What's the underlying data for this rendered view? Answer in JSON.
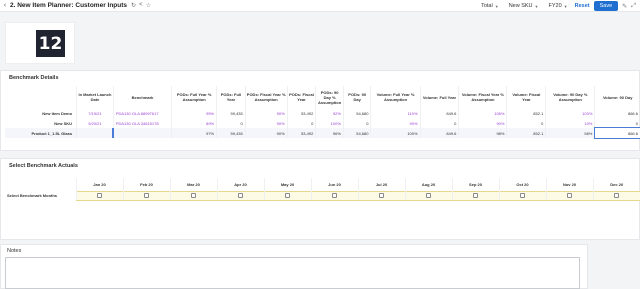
{
  "topbar": {
    "back_label": "‹",
    "title": "2. New Item Planner: Customer Inputs",
    "filters": [
      {
        "label": "Total"
      },
      {
        "label": "New SKU"
      },
      {
        "label": "FY20"
      }
    ],
    "reset_label": "Reset",
    "save_label": "Save"
  },
  "logo": {
    "text": "12"
  },
  "benchmark": {
    "title": "Benchmark Details",
    "columns": [
      "In Market Launch Date",
      "Benchmark",
      "PODs: Full Year % Assumption",
      "PODs: Full Year",
      "PODs: Fiscal Year % Assumption",
      "PODs: Fiscal Year",
      "PODs: 90 Day % Assumption",
      "PODs: 90 Day",
      "Volume: Full Year % Assumption",
      "Volume: Full Year",
      "Volume: Fiscal Year % Assumption",
      "Volume: Fiscal Year",
      "Volume: 90 Day % Assumption",
      "Volume: 90 Day"
    ],
    "rows": [
      {
        "label": "New Item Demo",
        "cells": [
          "7/19/21",
          "PDA130 GLA 68997617",
          "95%",
          "59,435",
          "90%",
          "53,492",
          "92%",
          "54,680",
          "110%",
          "849.6",
          "106%",
          "852.1",
          "103%",
          "866.6"
        ]
      },
      {
        "label": "New SKU",
        "cells": [
          "9/20/21",
          "PDA130 GLA 34615178",
          "89%",
          "0",
          "90%",
          "0",
          "100%",
          "0",
          "90%",
          "0",
          "90%",
          "0",
          "10%",
          "0"
        ]
      },
      {
        "label": "Product 1_1.5L Glass",
        "cells": [
          "",
          "",
          "97%",
          "59,435",
          "90%",
          "53,492",
          "96%",
          "54,680",
          "100%",
          "849.6",
          "98%",
          "852.1",
          "56%",
          "866.6"
        ]
      }
    ]
  },
  "actuals": {
    "title": "Select Benchmark Actuals",
    "row_label": "Select Benchmark Months",
    "months": [
      "Jan 20",
      "Feb 20",
      "Mar 20",
      "Apr 20",
      "May 20",
      "Jun 20",
      "Jul 20",
      "Aug 20",
      "Sep 20",
      "Oct 20",
      "Nov 20",
      "Dec 20"
    ]
  },
  "notes": {
    "title": "Notes"
  },
  "colors": {
    "accent": "#1f6fd1",
    "purple": "#9b3fd1",
    "highlight": "#fdfbe6"
  },
  "icons": [
    "refresh-icon",
    "share-icon",
    "star-icon",
    "chevron-down-icon",
    "edit-icon",
    "expand-icon"
  ]
}
